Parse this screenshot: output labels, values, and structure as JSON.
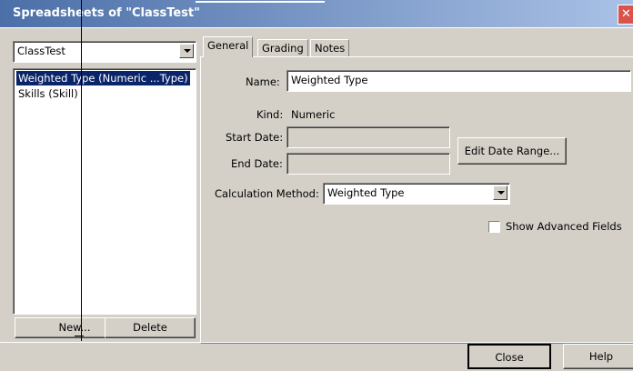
{
  "window": {
    "title": "Spreadsheets of \"ClassTest\"",
    "close_icon": "close-icon"
  },
  "left": {
    "class_select": {
      "value": "ClassTest"
    },
    "list": [
      {
        "label": "Weighted Type (Numeric ...Type)",
        "selected": true
      },
      {
        "label": "Skills (Skill)",
        "selected": false
      }
    ],
    "new_button": "New...",
    "delete_button": "Delete"
  },
  "tabs": [
    {
      "label": "General",
      "active": true
    },
    {
      "label": "Grading",
      "active": false
    },
    {
      "label": "Notes",
      "active": false
    }
  ],
  "general": {
    "name_label": "Name:",
    "name_value": "Weighted Type",
    "kind_label": "Kind:",
    "kind_value": "Numeric",
    "start_date_label": "Start Date:",
    "start_date_value": "",
    "end_date_label": "End Date:",
    "end_date_value": "",
    "edit_date_range_button": "Edit Date Range...",
    "calc_method_label": "Calculation Method:",
    "calc_method_value": "Weighted Type",
    "show_advanced_label": "Show Advanced Fields",
    "show_advanced_checked": false
  },
  "footer": {
    "close_button": "Close",
    "help_button": "Help"
  }
}
